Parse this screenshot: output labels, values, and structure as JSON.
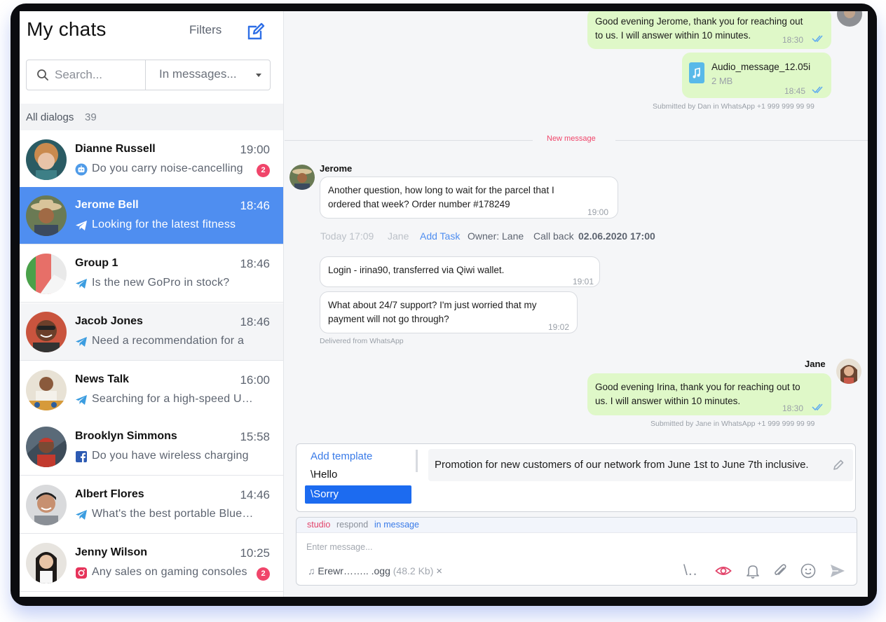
{
  "sidebar": {
    "title": "My chats",
    "filters_label": "Filters",
    "search_placeholder": "Search...",
    "search_scope": "In messages...",
    "all_dialogs_label": "All dialogs",
    "all_dialogs_count": "39",
    "chats": [
      {
        "name": "Dianne Russell",
        "time": "19:00",
        "preview": "Do you carry noise-cancelling",
        "channel": "bot-icon",
        "unread": "2"
      },
      {
        "name": "Jerome Bell",
        "time": "18:46",
        "preview": "Looking for the latest fitness",
        "channel": "telegram-icon"
      },
      {
        "name": "Group 1",
        "time": "18:46",
        "preview": "Is the new GoPro in stock?",
        "channel": "telegram-icon"
      },
      {
        "name": "Jacob Jones",
        "time": "18:46",
        "preview": "Need a recommendation for a",
        "channel": "telegram-icon"
      },
      {
        "name": "News Talk",
        "time": "16:00",
        "preview": "Searching for a high-speed USB-",
        "channel": "telegram-icon"
      },
      {
        "name": "Brooklyn Simmons",
        "time": "15:58",
        "preview": "Do you have wireless charging",
        "channel": "facebook-icon"
      },
      {
        "name": "Albert Flores",
        "time": "14:46",
        "preview": "What's the best portable Bluet…",
        "channel": "telegram-icon"
      },
      {
        "name": "Jenny Wilson",
        "time": "10:25",
        "preview": "Any sales on gaming consoles",
        "channel": "instagram-icon",
        "unread": "2"
      }
    ]
  },
  "conversation": {
    "out1": {
      "text_line1": "Good evening Jerome, thank you for reaching out",
      "text_line2": "to us. I will answer within 10 minutes.",
      "time": "18:30"
    },
    "audio": {
      "name": "Audio_message_12.05i",
      "size": "2 MB",
      "time": "18:45"
    },
    "submitted1": "Submitted by Dan in WhatsApp +1 999 999 99 99",
    "new_message_label": "New message",
    "in_sender": "Jerome",
    "in1": {
      "text_line1": "Another question, how long to wait for the parcel that I",
      "text_line2": "ordered that week? Order number #178249",
      "time": "19:00"
    },
    "activity": {
      "date": "Today 17:09",
      "agent": "Jane",
      "add_task": "Add Task",
      "owner": "Owner: Lane",
      "callback_label": "Call back",
      "callback_date": "02.06.2020 17:00"
    },
    "in2": {
      "text": "Login - irina90, transferred via Qiwi wallet.",
      "time": "19:01"
    },
    "in3": {
      "text_line1": "What about 24/7 support? I'm just worried that my",
      "text_line2": "payment will not go through?",
      "time": "19:02"
    },
    "delivered": "Delivered from WhatsApp",
    "out_sender": "Jane",
    "out2": {
      "text_line1": "Good evening Irina, thank you for reaching out to",
      "text_line2": "us. I will answer within 10 minutes.",
      "time": "18:30"
    },
    "submitted2": "Submitted by Jane in WhatsApp +1 999 999 99 99"
  },
  "templates": {
    "add_label": "Add template",
    "items": [
      "\\Hello",
      "\\Sorry"
    ],
    "selected": "\\Sorry",
    "preview": "Promotion for new customers of our network from June 1st to June 7th inclusive."
  },
  "composer": {
    "head_studio": "studio",
    "head_respond": "respond",
    "head_in_message": "in message",
    "placeholder": "Enter message...",
    "attachment_name": "Erewr…….. .ogg",
    "attachment_size": "(48.2 Kb)",
    "template_trigger": "\\..",
    "remove_symbol": "×"
  },
  "colors": {
    "accent": "#4f8ef0",
    "outgoing_bubble": "#dff8c8",
    "badge": "#f0456a",
    "selected_template": "#1c6bf0"
  }
}
